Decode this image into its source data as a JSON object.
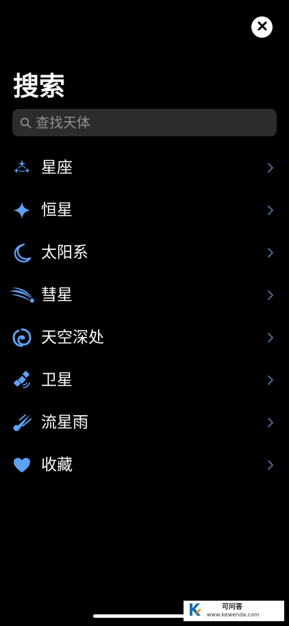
{
  "header": {
    "title": "搜索"
  },
  "search": {
    "placeholder": "查找天体",
    "value": ""
  },
  "colors": {
    "accent": "#5ea1f5",
    "background": "#000000",
    "search_bg": "#2c2c2f",
    "chevron": "#4a6b96"
  },
  "items": [
    {
      "label": "星座",
      "icon": "constellation-icon"
    },
    {
      "label": "恒星",
      "icon": "star-sparkle-icon"
    },
    {
      "label": "太阳系",
      "icon": "crescent-moon-icon"
    },
    {
      "label": "彗星",
      "icon": "comet-icon"
    },
    {
      "label": "天空深处",
      "icon": "galaxy-icon"
    },
    {
      "label": "卫星",
      "icon": "satellite-icon"
    },
    {
      "label": "流星雨",
      "icon": "meteor-icon"
    },
    {
      "label": "收藏",
      "icon": "heart-icon"
    }
  ],
  "watermark": {
    "title": "可问答",
    "url": "www.kewenda.com"
  }
}
